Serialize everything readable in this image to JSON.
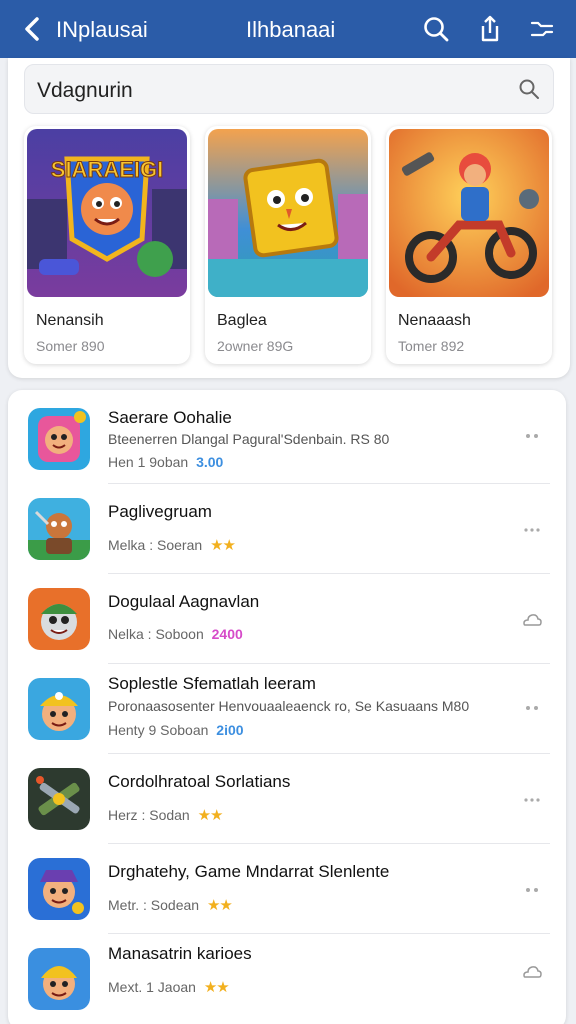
{
  "topbar": {
    "title": "INplausai",
    "center_title": "Ilhbanaai",
    "background": "#2b5ca8"
  },
  "search": {
    "query": "Vdagnurin"
  },
  "featured": [
    {
      "title": "Nenansih",
      "subtitle": "Somer 890",
      "icon": "strategy-game-art"
    },
    {
      "title": "Baglea",
      "subtitle": "2owner 89G",
      "icon": "cube-hero-game-art"
    },
    {
      "title": "Nenaaash",
      "subtitle": "Tomer 892",
      "icon": "motorbike-game-art"
    }
  ],
  "rows": [
    {
      "title": "Saerare Oohalie",
      "desc": "Bteenerren Dlangal Pagural'Sdenbain. RS 80",
      "meta": "Hen 1 9oban",
      "badge": "3.00",
      "badge_color": "#3d8fe0",
      "stars": "",
      "icon": "pink-hero-icon",
      "action": "more-dots-icon"
    },
    {
      "title": "Paglivegruam",
      "desc": "",
      "meta": "Melka : Soeran",
      "badge": "",
      "badge_color": "",
      "stars": "★★",
      "icon": "warrior-icon",
      "action": "more-dots-icon"
    },
    {
      "title": "Dogulaal Aagnavlan",
      "desc": "",
      "meta": "Nelka : Soboon",
      "badge": "2400",
      "badge_color": "#d64bc9",
      "stars": "",
      "icon": "robot-cap-icon",
      "action": "cloud-icon"
    },
    {
      "title": "Soplestle Sfematlah leeram",
      "desc": "Poronaasosenter Henvouaaleaenck ro, Se Kasuaans M80",
      "meta": "Henty 9 Soboan",
      "badge": "2i00",
      "badge_color": "#3d8fe0",
      "stars": "",
      "icon": "miner-boy-icon",
      "action": "more-dots-icon"
    },
    {
      "title": "Cordolhratoal Sorlatians",
      "desc": "",
      "meta": "Herz : Sodan",
      "badge": "",
      "badge_color": "",
      "stars": "★★",
      "icon": "weapons-icon",
      "action": "more-dots-icon"
    },
    {
      "title": "Drghatehy, Game Mndarrat Slenlente",
      "desc": "",
      "meta": "Metr. : Sodean",
      "badge": "",
      "badge_color": "",
      "stars": "★★",
      "icon": "pirate-hero-icon",
      "action": "more-dots-icon"
    },
    {
      "title": "Manasatrin karioes",
      "desc": "",
      "meta": "Mext. 1 Jaoan",
      "badge": "",
      "badge_color": "",
      "stars": "★★",
      "icon": "helmet-hero-icon",
      "action": "cloud-icon"
    }
  ]
}
